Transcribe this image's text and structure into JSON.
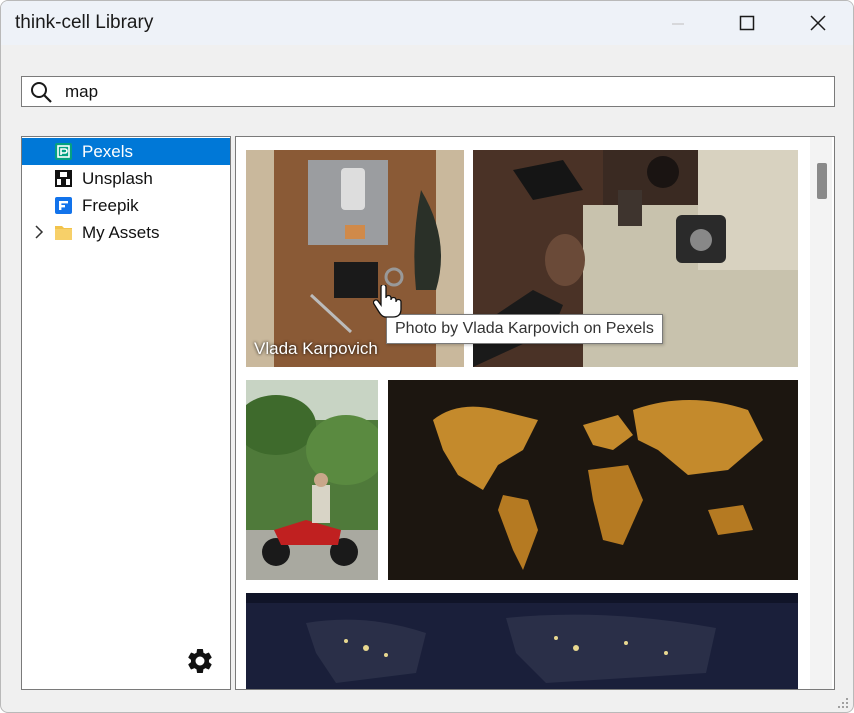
{
  "window": {
    "title": "think-cell Library"
  },
  "search": {
    "value": "map"
  },
  "sidebar": {
    "items": [
      {
        "label": "Pexels",
        "selected": true,
        "icon": "pexels-icon"
      },
      {
        "label": "Unsplash",
        "selected": false,
        "icon": "unsplash-icon"
      },
      {
        "label": "Freepik",
        "selected": false,
        "icon": "freepik-icon"
      },
      {
        "label": "My Assets",
        "selected": false,
        "icon": "folder-icon",
        "expandable": true
      }
    ]
  },
  "gallery": {
    "thumbnails": [
      {
        "caption": "Vlada Karpovich",
        "subject": "flat-lay travel items on map"
      },
      {
        "caption": "",
        "subject": "hand holding coffee over map with camera"
      },
      {
        "caption": "",
        "subject": "man on red motorcycle with palm trees"
      },
      {
        "caption": "",
        "subject": "golden world map on dark background"
      },
      {
        "caption": "",
        "subject": "night earth city lights"
      }
    ]
  },
  "tooltip": {
    "text": "Photo by Vlada Karpovich on Pexels"
  },
  "colors": {
    "selection": "#0078d7",
    "titlebar": "#eef2f8",
    "pexels": "#05a081",
    "freepik": "#1273eb",
    "folder": "#f2c34b"
  }
}
